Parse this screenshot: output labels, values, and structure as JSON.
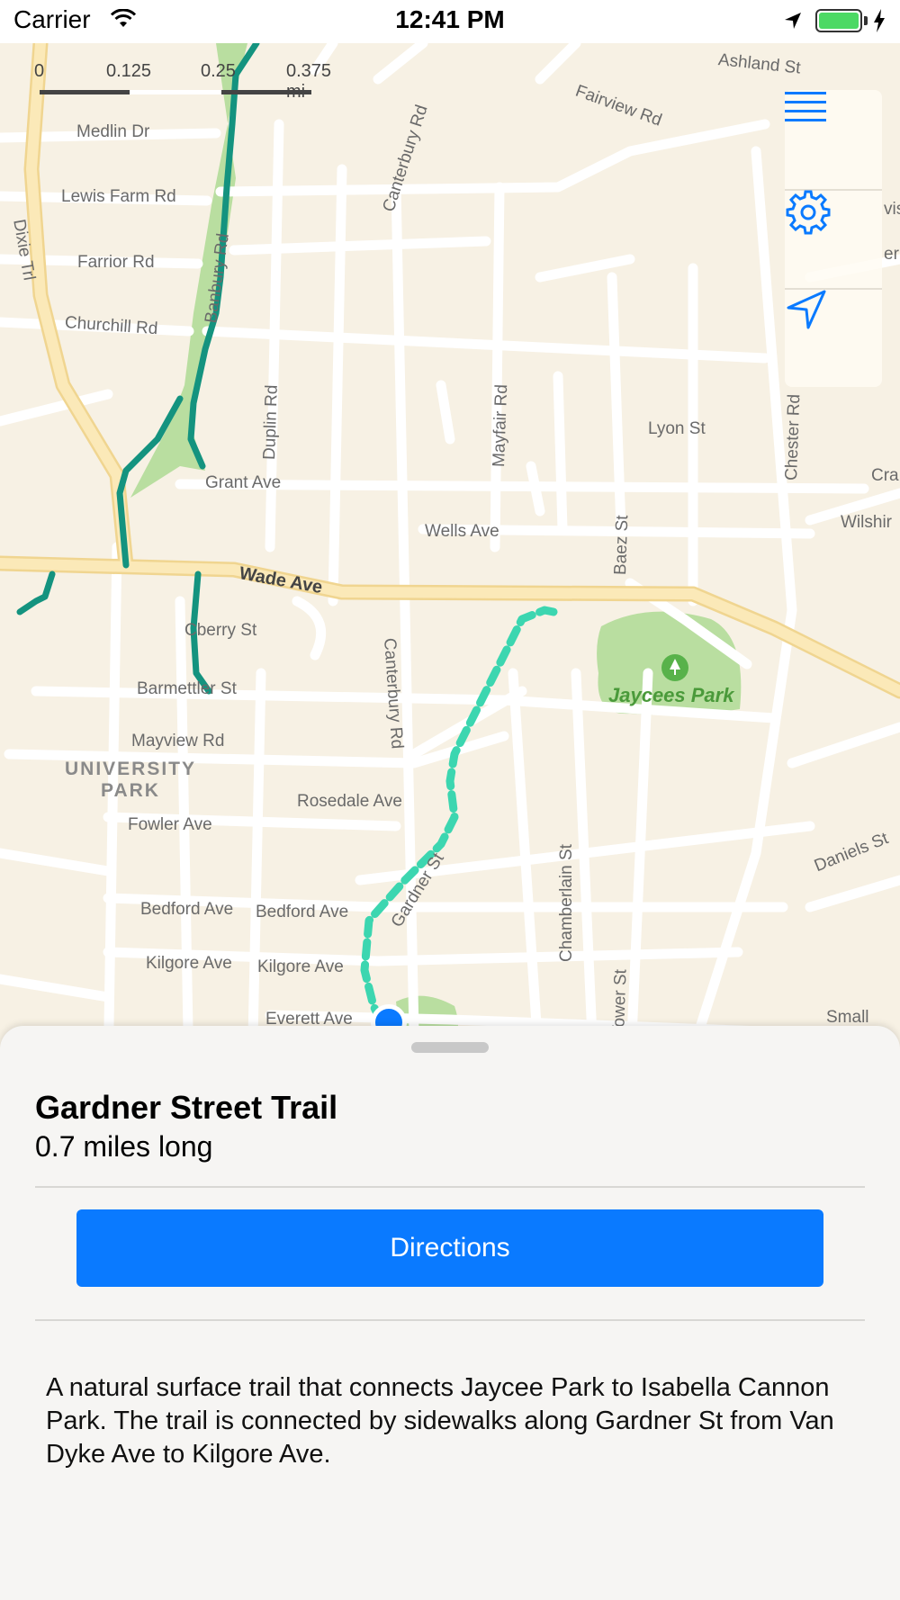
{
  "status_bar": {
    "carrier": "Carrier",
    "time": "12:41 PM"
  },
  "map": {
    "scale": {
      "ticks": [
        "0",
        "0.125",
        "0.25",
        "0.375 mi"
      ]
    },
    "streets": {
      "medlin": "Medlin Dr",
      "lewis_farm": "Lewis Farm Rd",
      "dixie": "Dixie Trl",
      "farrior": "Farrior Rd",
      "churchill": "Churchill Rd",
      "banbury": "Banbury Rd",
      "grant": "Grant Ave",
      "duplin": "Duplin Rd",
      "canterbury_top": "Canterbury Rd",
      "mayfair": "Mayfair Rd",
      "lyon": "Lyon St",
      "chester": "Chester Rd",
      "wells": "Wells Ave",
      "baez": "Baez St",
      "wade": "Wade Ave",
      "canterbury_mid": "Canterbury Rd",
      "cberry": "Cberry St",
      "barmettler": "Barmettler St",
      "mayview": "Mayview Rd",
      "rosedale": "Rosedale Ave",
      "fowler": "Fowler Ave",
      "gardner": "Gardner St",
      "chamberlain": "Chamberlain St",
      "bedford1": "Bedford Ave",
      "bedford2": "Bedford Ave",
      "kilgore1": "Kilgore Ave",
      "kilgore2": "Kilgore Ave",
      "everett": "Everett Ave",
      "tower": "Tower St",
      "daniels": "Daniels St",
      "ashland": "Ashland St",
      "fairview": "Fairview Rd",
      "cra": "Cra",
      "wilshire": "Wilshir",
      "small": "Small",
      "vis": "vis",
      "er": "er"
    },
    "district": "UNIVERSITY\nPARK",
    "park": "Jaycees Park",
    "colors": {
      "trail": "#14937f",
      "selected_trail": "#3cd6b0",
      "park": "#b9dea0",
      "major_road": "#fbe3a5",
      "accent": "#0a7aff"
    }
  },
  "controls": {
    "menu_icon": "hamburger-menu-icon",
    "settings_icon": "gear-icon",
    "location_icon": "location-arrow-icon"
  },
  "sheet": {
    "title": "Gardner Street Trail",
    "length": "0.7 miles long",
    "directions_label": "Directions",
    "description": "A natural surface trail that connects Jaycee Park to Isabella Cannon Park. The trail is connected by sidewalks along Gardner St from Van Dyke Ave to Kilgore Ave."
  }
}
